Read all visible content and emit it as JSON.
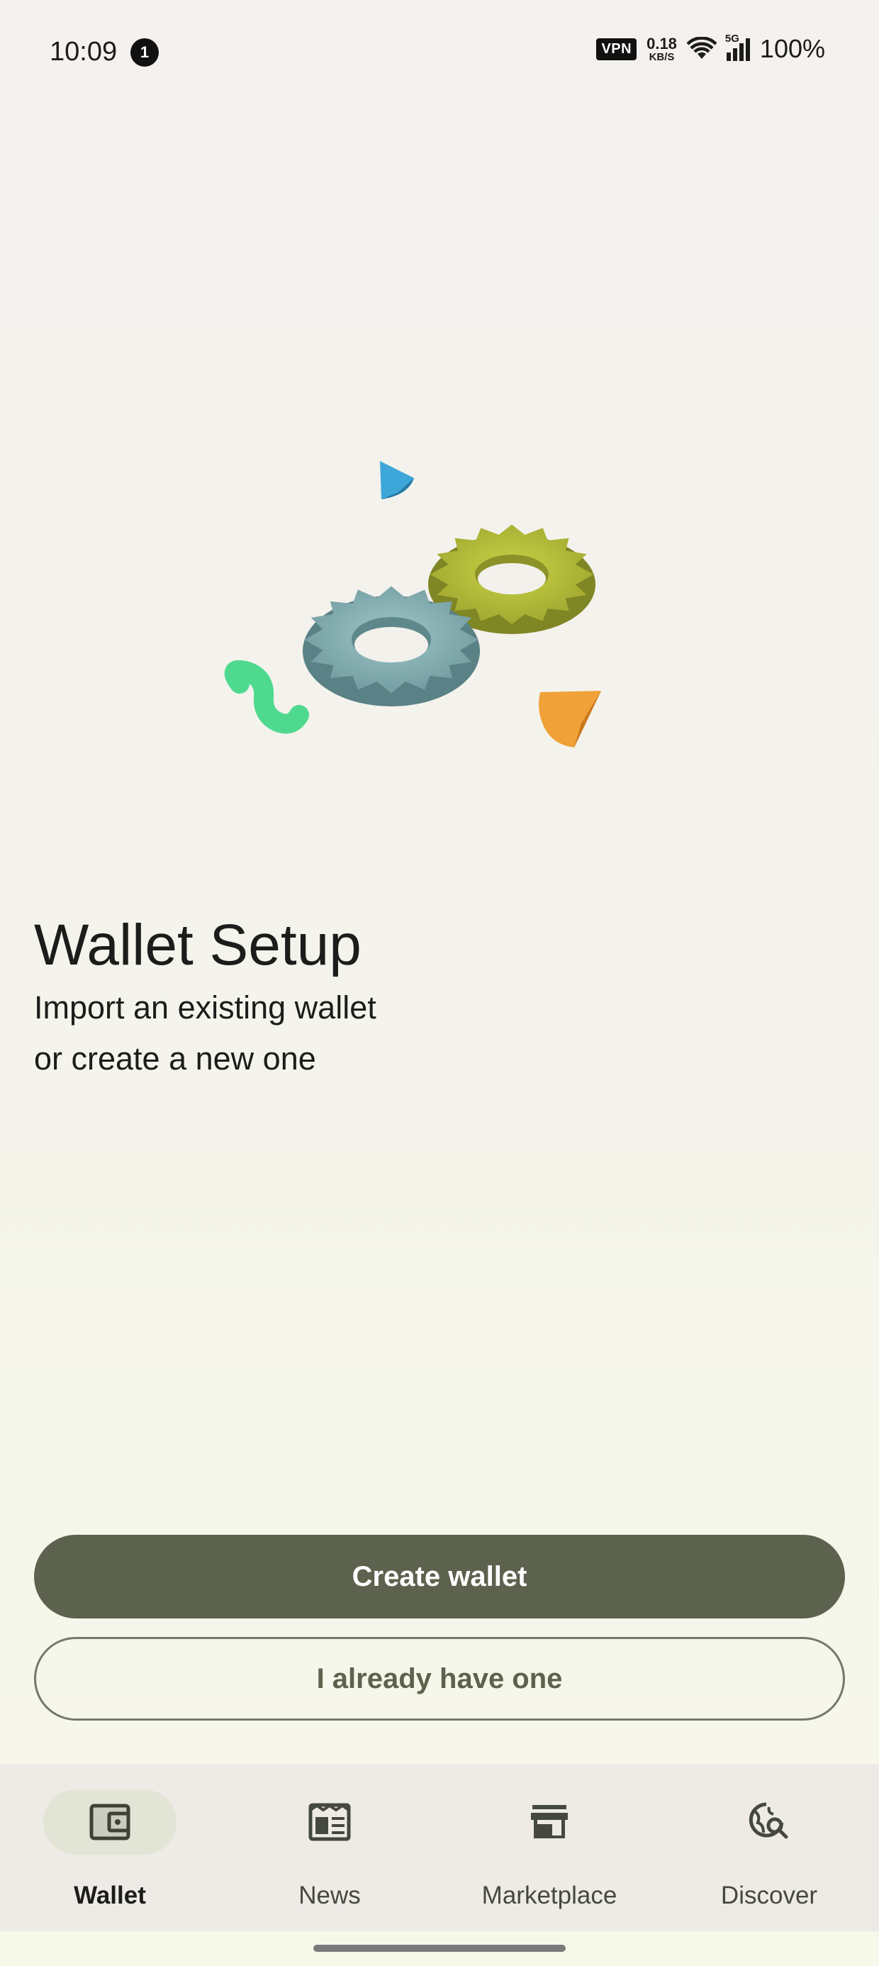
{
  "status_bar": {
    "time": "10:09",
    "notification_count": "1",
    "vpn": "VPN",
    "net_speed_value": "0.18",
    "net_speed_unit": "KB/S",
    "network_type": "5G",
    "battery": "100%"
  },
  "illustration": {
    "icon": "gears-illustration",
    "colors": {
      "blue_gear": "#8db7bb",
      "yellow_gear": "#b9c43a",
      "green_squiggle": "#4fd98f",
      "orange_cone": "#f0a138",
      "blue_cone": "#3ea7d9"
    }
  },
  "main": {
    "title": "Wallet Setup",
    "subtitle": "Import an existing wallet\n or create a new one"
  },
  "actions": {
    "create_label": "Create wallet",
    "import_label": "I already have one"
  },
  "nav": {
    "items": [
      {
        "label": "Wallet",
        "icon": "wallet-icon",
        "active": true
      },
      {
        "label": "News",
        "icon": "news-icon",
        "active": false
      },
      {
        "label": "Marketplace",
        "icon": "storefront-icon",
        "active": false
      },
      {
        "label": "Discover",
        "icon": "travel-explore-icon",
        "active": false
      }
    ]
  },
  "colors": {
    "primary": "#5c624d",
    "outline": "#74786a",
    "nav_background": "#eeebe6",
    "active_indicator": "#e2e4d6"
  }
}
